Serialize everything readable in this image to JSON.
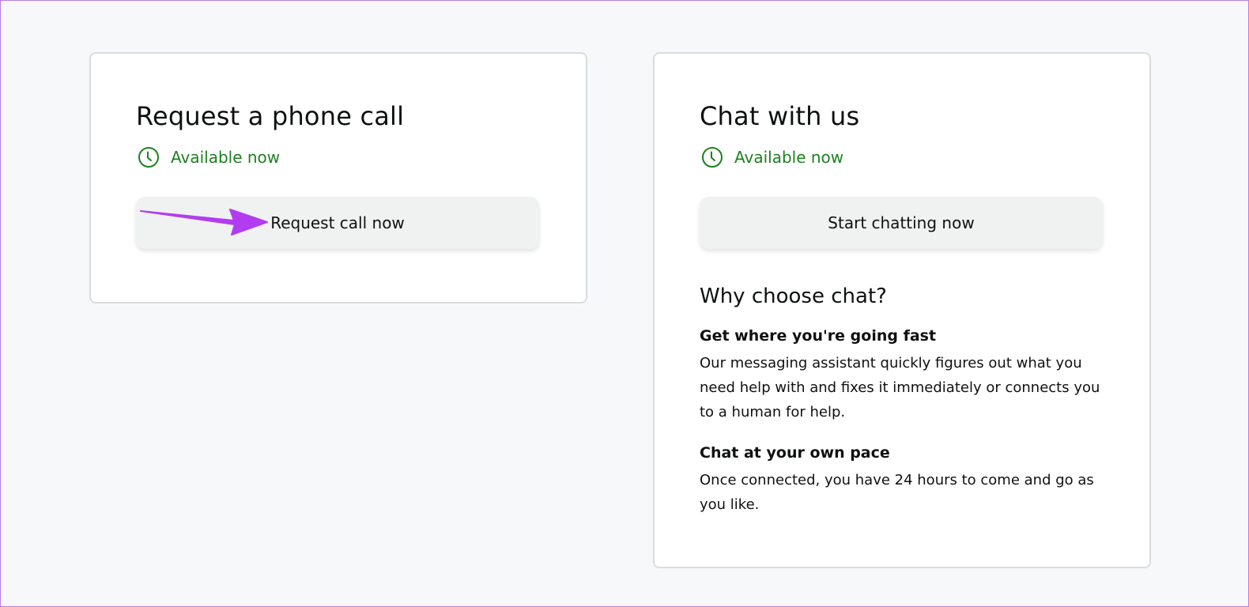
{
  "call_card": {
    "title": "Request a phone call",
    "availability": "Available now",
    "button_label": "Request call now"
  },
  "chat_card": {
    "title": "Chat with us",
    "availability": "Available now",
    "button_label": "Start chatting now",
    "why_heading": "Why choose chat?",
    "benefits": [
      {
        "title": "Get where you're going fast",
        "text": "Our messaging assistant quickly figures out what you need help with and fixes it immediately or connects you to a human for help."
      },
      {
        "title": "Chat at your own pace",
        "text": "Once connected, you have 24 hours to come and go as you like."
      }
    ]
  },
  "icons": {
    "availability": "clock-icon",
    "annotation": "arrow-icon"
  },
  "colors": {
    "page_background": "#f7f8fa",
    "card_border": "#dadcdf",
    "available_green": "#1d8120",
    "button_background": "#f0f2f2",
    "annotation_arrow": "#b23cf0"
  }
}
